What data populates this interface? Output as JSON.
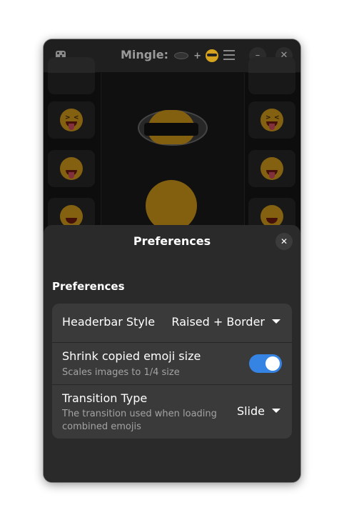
{
  "window": {
    "title": "Mingle:",
    "title_plus": "+"
  },
  "headerbar": {
    "icons": [
      "dice-icon",
      "menu-icon",
      "minimize-icon",
      "close-icon"
    ],
    "minimize_glyph": "–",
    "close_glyph": "✕"
  },
  "preferences": {
    "dialog_title": "Preferences",
    "close_glyph": "✕",
    "group_title": "Preferences",
    "rows": [
      {
        "title": "Headerbar Style",
        "value": "Raised + Border"
      },
      {
        "title": "Shrink copied emoji size",
        "subtitle": "Scales images to 1/4 size",
        "toggle": true
      },
      {
        "title": "Transition Type",
        "subtitle": "The transition used when loading combined emojis",
        "value": "Slide"
      }
    ]
  },
  "colors": {
    "accent": "#3584e4",
    "dialog_bg": "#2a2a2a",
    "row_bg": "#3a3a3a"
  }
}
